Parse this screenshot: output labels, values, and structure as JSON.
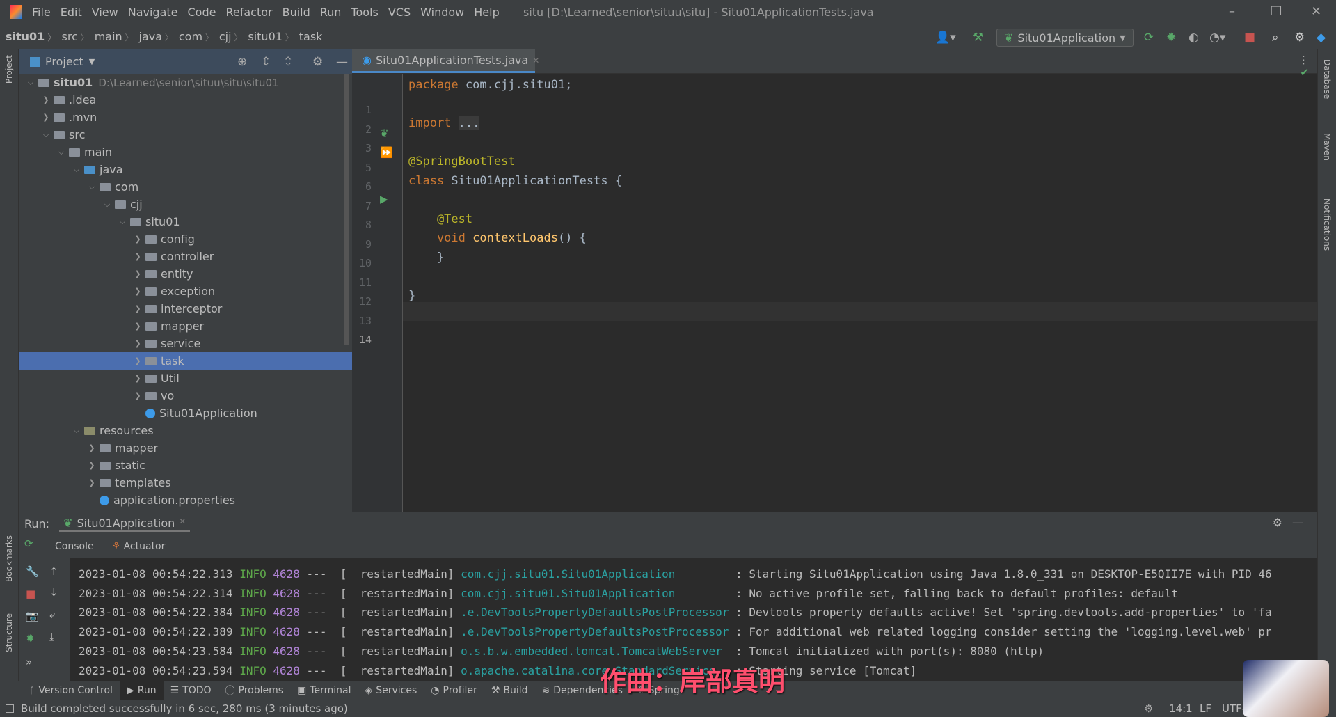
{
  "menu": {
    "items": [
      "File",
      "Edit",
      "View",
      "Navigate",
      "Code",
      "Refactor",
      "Build",
      "Run",
      "Tools",
      "VCS",
      "Window",
      "Help"
    ],
    "title": "situ [D:\\Learned\\senior\\situu\\situ] - Situ01ApplicationTests.java"
  },
  "breadcrumb": [
    "situ01",
    "src",
    "main",
    "java",
    "com",
    "cjj",
    "situ01",
    "task"
  ],
  "run_config": "Situ01Application",
  "left_stripe": {
    "project": "Project",
    "bookmarks": "Bookmarks",
    "structure": "Structure"
  },
  "right_stripe": {
    "database": "Database",
    "maven": "Maven",
    "notifications": "Notifications"
  },
  "project": {
    "title": "Project",
    "root_path": "D:\\Learned\\senior\\situu\\situ\\situ01",
    "tree": [
      {
        "label": "situ01",
        "depth": 0,
        "open": true,
        "kind": "module"
      },
      {
        "label": ".idea",
        "depth": 1,
        "open": false,
        "kind": "folder"
      },
      {
        "label": ".mvn",
        "depth": 1,
        "open": false,
        "kind": "folder"
      },
      {
        "label": "src",
        "depth": 1,
        "open": true,
        "kind": "folder"
      },
      {
        "label": "main",
        "depth": 2,
        "open": true,
        "kind": "folder"
      },
      {
        "label": "java",
        "depth": 3,
        "open": true,
        "kind": "src"
      },
      {
        "label": "com",
        "depth": 4,
        "open": true,
        "kind": "pkg"
      },
      {
        "label": "cjj",
        "depth": 5,
        "open": true,
        "kind": "pkg"
      },
      {
        "label": "situ01",
        "depth": 6,
        "open": true,
        "kind": "pkg"
      },
      {
        "label": "config",
        "depth": 7,
        "open": false,
        "kind": "pkg"
      },
      {
        "label": "controller",
        "depth": 7,
        "open": false,
        "kind": "pkg"
      },
      {
        "label": "entity",
        "depth": 7,
        "open": false,
        "kind": "pkg"
      },
      {
        "label": "exception",
        "depth": 7,
        "open": false,
        "kind": "pkg"
      },
      {
        "label": "interceptor",
        "depth": 7,
        "open": false,
        "kind": "pkg"
      },
      {
        "label": "mapper",
        "depth": 7,
        "open": false,
        "kind": "pkg"
      },
      {
        "label": "service",
        "depth": 7,
        "open": false,
        "kind": "pkg"
      },
      {
        "label": "task",
        "depth": 7,
        "open": false,
        "kind": "pkg",
        "selected": true
      },
      {
        "label": "Util",
        "depth": 7,
        "open": false,
        "kind": "pkg"
      },
      {
        "label": "vo",
        "depth": 7,
        "open": false,
        "kind": "pkg"
      },
      {
        "label": "Situ01Application",
        "depth": 7,
        "kind": "class"
      },
      {
        "label": "resources",
        "depth": 3,
        "open": true,
        "kind": "res"
      },
      {
        "label": "mapper",
        "depth": 4,
        "open": false,
        "kind": "folder"
      },
      {
        "label": "static",
        "depth": 4,
        "open": false,
        "kind": "folder"
      },
      {
        "label": "templates",
        "depth": 4,
        "open": false,
        "kind": "folder"
      },
      {
        "label": "application.properties",
        "depth": 4,
        "kind": "file"
      }
    ]
  },
  "editor": {
    "tab": "Situ01ApplicationTests.java",
    "lines": [
      {
        "n": "1",
        "t": [
          [
            "kw",
            "package "
          ],
          [
            "",
            "com.cjj.situ01;"
          ]
        ]
      },
      {
        "n": "2",
        "t": []
      },
      {
        "n": "3",
        "t": [
          [
            "kw",
            "import "
          ],
          [
            "fold",
            "..."
          ]
        ]
      },
      {
        "n": "5",
        "t": []
      },
      {
        "n": "6",
        "t": [
          [
            "an",
            "@SpringBootTest"
          ]
        ]
      },
      {
        "n": "7",
        "t": [
          [
            "kw",
            "class "
          ],
          [
            "",
            "Situ01ApplicationTests {"
          ]
        ]
      },
      {
        "n": "8",
        "t": []
      },
      {
        "n": "9",
        "t": [
          [
            "an",
            "    @Test"
          ]
        ]
      },
      {
        "n": "10",
        "t": [
          [
            "kw",
            "    void "
          ],
          [
            "fn",
            "contextLoads"
          ],
          [
            "",
            "() {"
          ]
        ]
      },
      {
        "n": "11",
        "t": [
          [
            "",
            "    }"
          ]
        ]
      },
      {
        "n": "12",
        "t": []
      },
      {
        "n": "13",
        "t": [
          [
            "",
            "}"
          ]
        ]
      },
      {
        "n": "14",
        "t": []
      }
    ]
  },
  "run": {
    "label": "Run:",
    "tab": "Situ01Application",
    "console": "Console",
    "actuator": "Actuator",
    "logs": [
      {
        "ts": "2023-01-08 00:54:22.313",
        "lvl": "INFO",
        "pid": "4628",
        "thread": "---  [  restartedMain]",
        "cls": "com.cjj.situ01.Situ01Application        ",
        "msg": ": Starting Situ01Application using Java 1.8.0_331 on DESKTOP-E5QII7E with PID 46"
      },
      {
        "ts": "2023-01-08 00:54:22.314",
        "lvl": "INFO",
        "pid": "4628",
        "thread": "---  [  restartedMain]",
        "cls": "com.cjj.situ01.Situ01Application        ",
        "msg": ": No active profile set, falling back to default profiles: default"
      },
      {
        "ts": "2023-01-08 00:54:22.384",
        "lvl": "INFO",
        "pid": "4628",
        "thread": "---  [  restartedMain]",
        "cls": ".e.DevToolsPropertyDefaultsPostProcessor",
        "msg": ": Devtools property defaults active! Set 'spring.devtools.add-properties' to 'fa"
      },
      {
        "ts": "2023-01-08 00:54:22.389",
        "lvl": "INFO",
        "pid": "4628",
        "thread": "---  [  restartedMain]",
        "cls": ".e.DevToolsPropertyDefaultsPostProcessor",
        "msg": ": For additional web related logging consider setting the 'logging.level.web' pr"
      },
      {
        "ts": "2023-01-08 00:54:23.584",
        "lvl": "INFO",
        "pid": "4628",
        "thread": "---  [  restartedMain]",
        "cls": "o.s.b.w.embedded.tomcat.TomcatWebServer ",
        "msg": ": Tomcat initialized with port(s): 8080 (http)"
      },
      {
        "ts": "2023-01-08 00:54:23.594",
        "lvl": "INFO",
        "pid": "4628",
        "thread": "---  [  restartedMain]",
        "cls": "o.apache.catalina.core.StandardService  ",
        "msg": ": Starting service [Tomcat]"
      }
    ]
  },
  "toolwindows": [
    "Version Control",
    "Run",
    "TODO",
    "Problems",
    "Terminal",
    "Services",
    "Profiler",
    "Build",
    "Dependencies",
    "Spring"
  ],
  "status": {
    "message": "Build completed successfully in 6 sec, 280 ms (3 minutes ago)",
    "position": "14:1",
    "line_sep": "LF",
    "encoding": "UTF-"
  },
  "overlay_caption": "作曲：岸部真明"
}
